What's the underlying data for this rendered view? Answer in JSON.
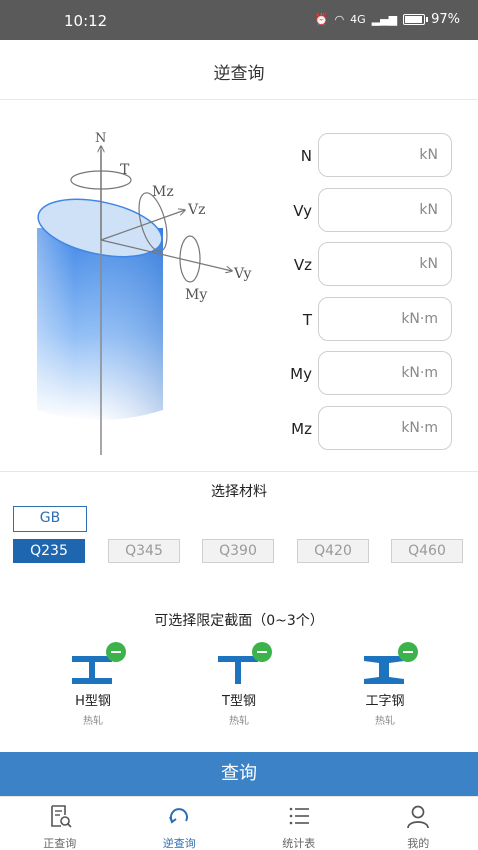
{
  "status_bar": {
    "time": "10:12",
    "network": "4G",
    "battery_text": "97%",
    "battery_level": 0.97
  },
  "header": {
    "title": "逆查询"
  },
  "diagram": {
    "labels": {
      "n": "N",
      "t": "T",
      "mz": "Mz",
      "vz": "Vz",
      "vy": "Vy",
      "my": "My"
    }
  },
  "forces": [
    {
      "label": "N",
      "unit": "kN",
      "value": ""
    },
    {
      "label": "Vy",
      "unit": "kN",
      "value": ""
    },
    {
      "label": "Vz",
      "unit": "kN",
      "value": ""
    },
    {
      "label": "T",
      "unit": "kN·m",
      "value": ""
    },
    {
      "label": "My",
      "unit": "kN·m",
      "value": ""
    },
    {
      "label": "Mz",
      "unit": "kN·m",
      "value": ""
    }
  ],
  "material": {
    "title": "选择材料",
    "standard": "GB",
    "grades": [
      "Q235",
      "Q345",
      "Q390",
      "Q420",
      "Q460"
    ],
    "selected_grade": "Q235"
  },
  "sections": {
    "title": "可选择限定截面（0~3个）",
    "items": [
      {
        "name": "H型钢",
        "sub": "热轧",
        "icon": "h-beam-icon"
      },
      {
        "name": "T型钢",
        "sub": "热轧",
        "icon": "t-beam-icon"
      },
      {
        "name": "工字钢",
        "sub": "热轧",
        "icon": "i-beam-icon"
      }
    ]
  },
  "query_button": "查询",
  "nav": [
    {
      "label": "正查询",
      "icon": "document-search-icon",
      "active": false
    },
    {
      "label": "逆查询",
      "icon": "refresh-icon",
      "active": true
    },
    {
      "label": "统计表",
      "icon": "list-icon",
      "active": false
    },
    {
      "label": "我的",
      "icon": "person-icon",
      "active": false
    }
  ],
  "colors": {
    "primary": "#1e67b0",
    "button": "#3c82c7",
    "badge": "#3bb34a",
    "icon": "#1e73be"
  }
}
